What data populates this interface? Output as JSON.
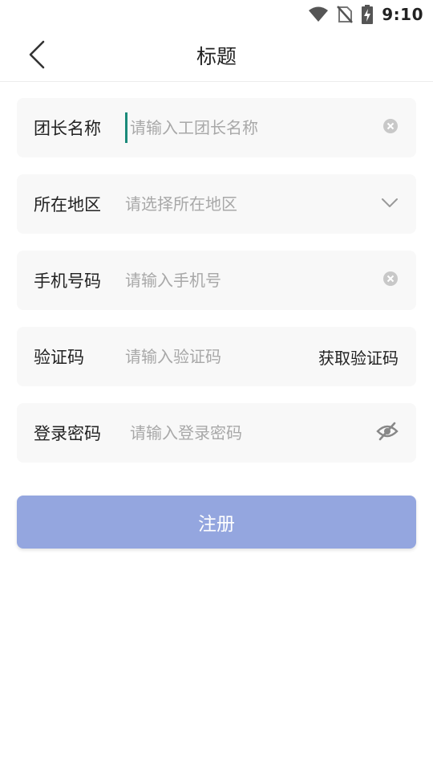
{
  "status_bar": {
    "time": "9:10",
    "icons": [
      "wifi-icon",
      "no-sim-icon",
      "battery-charging-icon"
    ]
  },
  "header": {
    "title": "标题",
    "back_icon": "chevron-left-icon"
  },
  "form": {
    "leader_name": {
      "label": "团长名称",
      "placeholder": "请输入工团长名称",
      "value": "",
      "trailing_icon": "clear-icon"
    },
    "region": {
      "label": "所在地区",
      "placeholder": "请选择所在地区",
      "value": "",
      "trailing_icon": "chevron-down-icon"
    },
    "phone": {
      "label": "手机号码",
      "placeholder": "请输入手机号",
      "value": "",
      "trailing_icon": "clear-icon"
    },
    "code": {
      "label": "验证码",
      "placeholder": "请输入验证码",
      "value": "",
      "action_label": "获取验证码"
    },
    "password": {
      "label": "登录密码",
      "placeholder": "请输入登录密码",
      "value": "",
      "trailing_icon": "eye-off-icon"
    }
  },
  "submit": {
    "label": "注册"
  },
  "colors": {
    "primary": "#94a6df",
    "row_bg": "#f8f8f8",
    "placeholder": "#a8a8a8",
    "cursor": "#1a8a7a"
  }
}
